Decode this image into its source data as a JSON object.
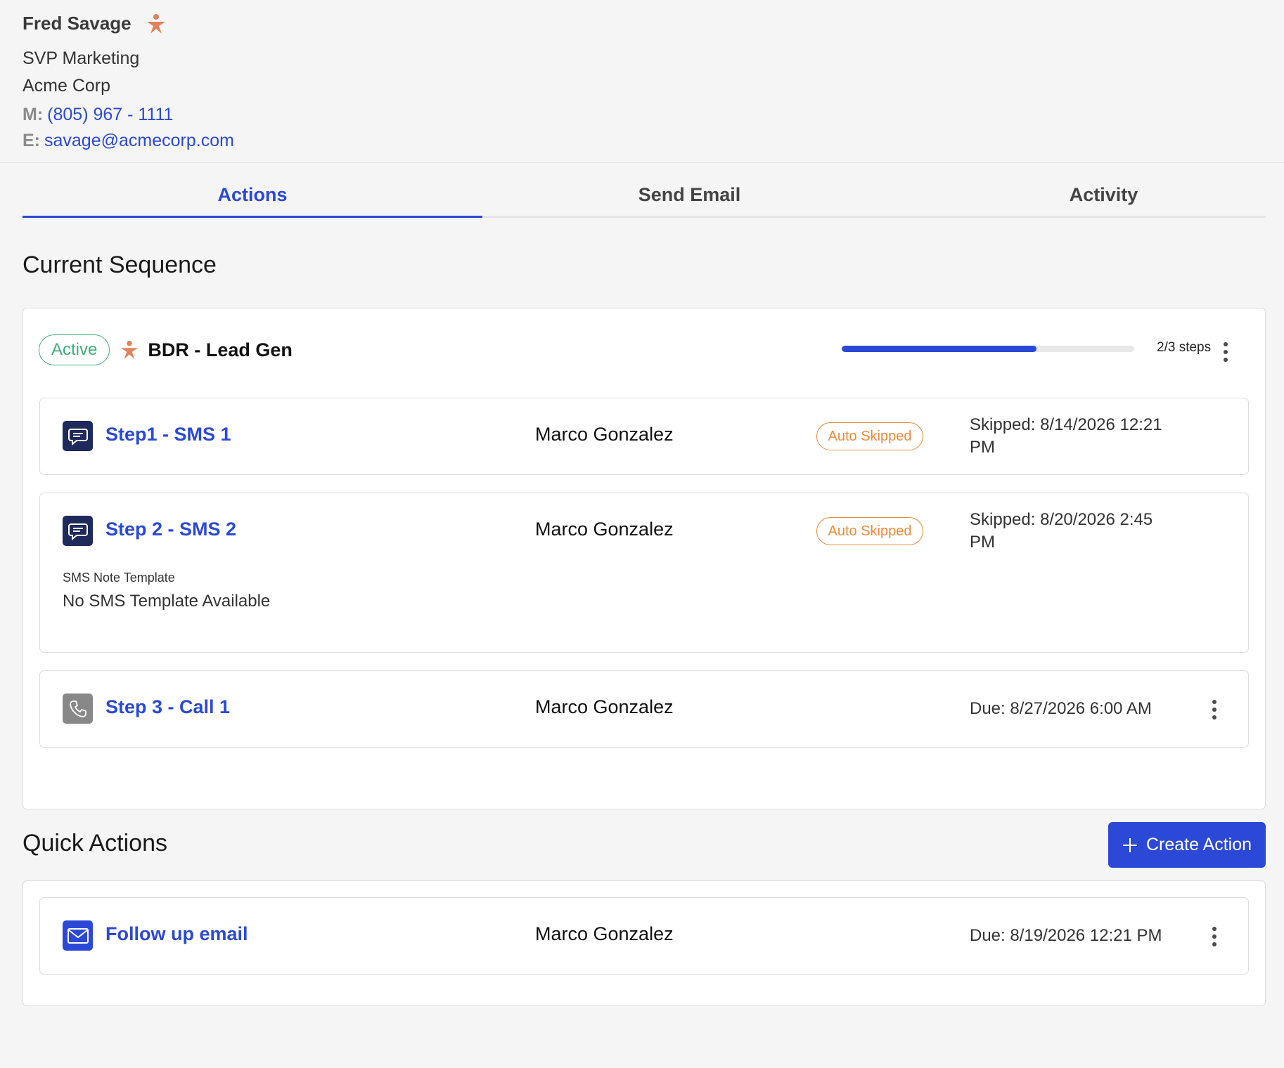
{
  "contact": {
    "name": "Fred Savage",
    "title": "SVP Marketing",
    "company": "Acme Corp",
    "mobile_label": "M:",
    "mobile": "(805) 967 - 1111",
    "email_label": "E:",
    "email": "savage@acmecorp.com",
    "star_icon": "person-star-icon"
  },
  "tabs": [
    {
      "label": "Actions",
      "active": true
    },
    {
      "label": "Send Email",
      "active": false
    },
    {
      "label": "Activity",
      "active": false
    }
  ],
  "sequence": {
    "heading": "Current Sequence",
    "status": "Active",
    "name": "BDR - Lead Gen",
    "progress": 0.667,
    "progress_label": "2/3 steps",
    "steps": [
      {
        "icon": "sms-icon",
        "label": "Step1 - SMS 1",
        "assignee": "Marco Gonzalez",
        "status": "Auto Skipped",
        "when": "Skipped: 8/14/2026 12:21 PM"
      },
      {
        "icon": "sms-icon",
        "label": "Step 2 - SMS 2",
        "assignee": "Marco Gonzalez",
        "status": "Auto Skipped",
        "when": "Skipped: 8/20/2026 2:45 PM",
        "note_label": "SMS Note Template",
        "note_value": "No SMS Template Available"
      },
      {
        "icon": "phone-icon",
        "label": "Step 3 - Call 1",
        "assignee": "Marco Gonzalez",
        "when": "Due: 8/27/2026 6:00 AM"
      }
    ]
  },
  "quick_actions": {
    "heading": "Quick Actions",
    "create_label": "Create Action",
    "items": [
      {
        "icon": "mail-icon",
        "label": "Follow up email",
        "assignee": "Marco Gonzalez",
        "when": "Due: 8/19/2026 12:21 PM"
      }
    ]
  },
  "colors": {
    "accent": "#2b49d6",
    "active_green": "#3fae78",
    "skipped_orange": "#f08a36",
    "star_orange": "#e0825a"
  }
}
